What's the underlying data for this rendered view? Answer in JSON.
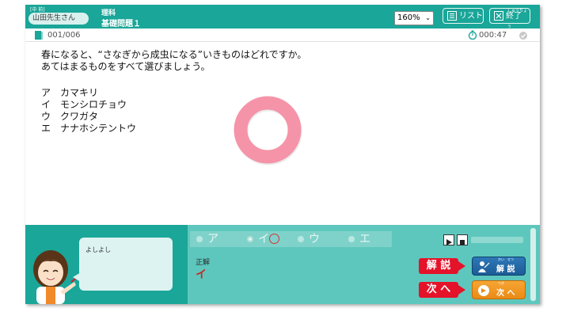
{
  "header": {
    "small_caption": "[中 前]",
    "user_name": "山田先生さん",
    "subject": "理科",
    "lesson_title": "基礎問題１",
    "zoom": "160%",
    "list_label": "リスト",
    "end_label": "終了",
    "end_ruby": "しゅうりょう"
  },
  "meta": {
    "counter": "001/006",
    "timer": "000:47"
  },
  "question": {
    "lines": [
      "春になると、“さなぎから成虫になる”いきものはどれですか。",
      "あてはまるものをすべて選びましょう。"
    ],
    "choices": [
      {
        "key": "ア",
        "text": "カマキリ"
      },
      {
        "key": "イ",
        "text": "モンシロチョウ"
      },
      {
        "key": "ウ",
        "text": "クワガタ"
      },
      {
        "key": "エ",
        "text": "ナナホシテントウ"
      }
    ]
  },
  "feedback": {
    "ring_color": "#f594a8",
    "speech": "よしよし"
  },
  "answer": {
    "options": [
      "ア",
      "イ",
      "ウ",
      "エ"
    ],
    "selected": "イ",
    "correct_label": "正解",
    "correct_value": "イ"
  },
  "actions": {
    "explain_tag": "解 説",
    "explain_label": "解 説",
    "explain_ruby": "かい　せつ",
    "next_tag": "次 へ",
    "next_label": "次 へ",
    "next_ruby": "つぎ"
  },
  "colors": {
    "teal": "#1aa699",
    "teal_light": "#5ec7bd",
    "red": "#e4132a",
    "blue": "#1d5c97",
    "orange": "#ea8a16"
  }
}
